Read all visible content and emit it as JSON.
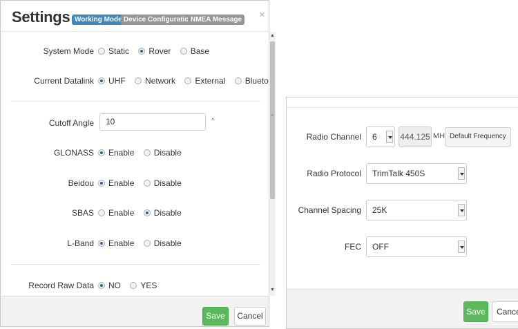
{
  "settings": {
    "title": "Settings",
    "tabs": [
      "Working Mode",
      "Device Configuration",
      "NMEA Message"
    ],
    "close_glyph": "×",
    "system_mode": {
      "label": "System Mode",
      "options": [
        "Static",
        "Rover",
        "Base"
      ],
      "selected": "Rover"
    },
    "datalink": {
      "label": "Current Datalink",
      "options": [
        "UHF",
        "Network",
        "External",
        "Bluetooth"
      ],
      "selected": "UHF"
    },
    "cutoff": {
      "label": "Cutoff Angle",
      "value": "10",
      "unit": "°"
    },
    "glonass": {
      "label": "GLONASS",
      "options": [
        "Enable",
        "Disable"
      ],
      "selected": "Enable"
    },
    "beidou": {
      "label": "Beidou",
      "options": [
        "Enable",
        "Disable"
      ],
      "selected": "Enable"
    },
    "sbas": {
      "label": "SBAS",
      "options": [
        "Enable",
        "Disable"
      ],
      "selected": "Disable"
    },
    "lband": {
      "label": "L-Band",
      "options": [
        "Enable",
        "Disable"
      ],
      "selected": "Enable"
    },
    "record": {
      "label": "Record Raw Data",
      "options": [
        "NO",
        "YES"
      ],
      "selected": "NO"
    },
    "save_label": "Save",
    "cancel_label": "Cancel"
  },
  "radio": {
    "channel": {
      "label": "Radio Channel",
      "value": "6",
      "frequency": "444.125",
      "unit": "MHz",
      "default_button": "Default Frequency"
    },
    "protocol": {
      "label": "Radio Protocol",
      "value": "TrimTalk 450S"
    },
    "spacing": {
      "label": "Channel Spacing",
      "value": "25K"
    },
    "fec": {
      "label": "FEC",
      "value": "OFF"
    },
    "save_label": "Save",
    "cancel_label": "Cancel"
  },
  "colors": {
    "active_tab": "#3f87c1",
    "inactive_tab": "#959595",
    "save_button": "#5cb85c",
    "radio_dot": "#2a5fa8"
  }
}
